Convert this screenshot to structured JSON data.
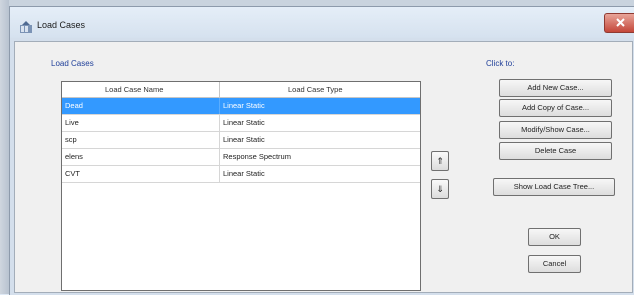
{
  "window": {
    "title": "Load Cases"
  },
  "load_cases_group": {
    "label": "Load Cases"
  },
  "table": {
    "headers": [
      "Load Case Name",
      "Load Case Type"
    ],
    "rows": [
      {
        "name": "Dead",
        "type": "Linear Static",
        "selected": true
      },
      {
        "name": "Live",
        "type": "Linear Static",
        "selected": false
      },
      {
        "name": "scp",
        "type": "Linear Static",
        "selected": false
      },
      {
        "name": "elens",
        "type": "Response Spectrum",
        "selected": false
      },
      {
        "name": "CVT",
        "type": "Linear Static",
        "selected": false
      }
    ]
  },
  "order_buttons": {
    "up": "⇑",
    "down": "⇓"
  },
  "click_to": {
    "label": "Click to:"
  },
  "buttons": {
    "add_new": "Add New Case...",
    "add_copy": "Add Copy of Case...",
    "modify_show": "Modify/Show Case...",
    "delete": "Delete Case",
    "show_tree": "Show Load Case Tree...",
    "ok": "OK",
    "cancel": "Cancel"
  },
  "colors": {
    "selection": "#3399ff",
    "group_label": "#21409a",
    "close_button": "#c4473a"
  },
  "icons": {
    "window": "load-cases-app-icon",
    "close": "close-icon",
    "up": "move-up-icon",
    "down": "move-down-icon"
  }
}
